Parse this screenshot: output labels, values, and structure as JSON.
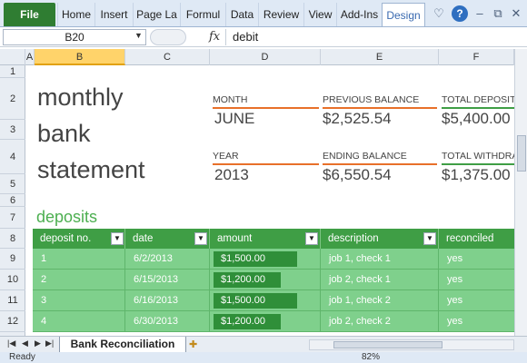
{
  "ribbon": {
    "file_label": "File",
    "tabs": [
      "Home",
      "Insert",
      "Page La",
      "Formul",
      "Data",
      "Review",
      "View",
      "Add-Ins",
      "Design"
    ],
    "active_tab": "Design"
  },
  "formula_bar": {
    "name_box": "B20",
    "fx_label": "fx",
    "value": "debit"
  },
  "grid": {
    "columns": [
      "A",
      "B",
      "C",
      "D",
      "E",
      "F"
    ],
    "selected_column": "B",
    "rows": [
      "1",
      "2",
      "3",
      "4",
      "5",
      "6",
      "7",
      "8",
      "9",
      "10",
      "11",
      "12"
    ]
  },
  "statement": {
    "title_lines": [
      "monthly",
      "bank",
      "statement"
    ],
    "month_label": "MONTH",
    "month_value": "JUNE",
    "prev_balance_label": "PREVIOUS BALANCE",
    "prev_balance_value": "$2,525.54",
    "total_deposits_label": "TOTAL DEPOSITS",
    "total_deposits_value": "$5,400.00",
    "year_label": "YEAR",
    "year_value": "2013",
    "ending_balance_label": "ENDING BALANCE",
    "ending_balance_value": "$6,550.54",
    "total_withdrawals_label": "TOTAL WITHDRA",
    "total_withdrawals_value": "$1,375.00",
    "colors": {
      "orange": "#e8702a",
      "green": "#3f9e45",
      "light_green": "#7fd08c"
    }
  },
  "deposits": {
    "title": "deposits",
    "headers": [
      "deposit no.",
      "date",
      "amount",
      "description",
      "reconciled"
    ],
    "rows": [
      {
        "no": "1",
        "date": "6/2/2013",
        "amount": "$1,500.00",
        "amount_fill": 1.0,
        "description": "job 1, check 1",
        "reconciled": "yes"
      },
      {
        "no": "2",
        "date": "6/15/2013",
        "amount": "$1,200.00",
        "amount_fill": 0.8,
        "description": "job 2, check 1",
        "reconciled": "yes"
      },
      {
        "no": "3",
        "date": "6/16/2013",
        "amount": "$1,500.00",
        "amount_fill": 1.0,
        "description": "job 1, check 2",
        "reconciled": "yes"
      },
      {
        "no": "4",
        "date": "6/30/2013",
        "amount": "$1,200.00",
        "amount_fill": 0.8,
        "description": "job 2, check 2",
        "reconciled": "yes"
      }
    ]
  },
  "sheet_tabs": {
    "active": "Bank Reconciliation"
  },
  "status": {
    "text": "Ready",
    "zoom": "82%"
  }
}
